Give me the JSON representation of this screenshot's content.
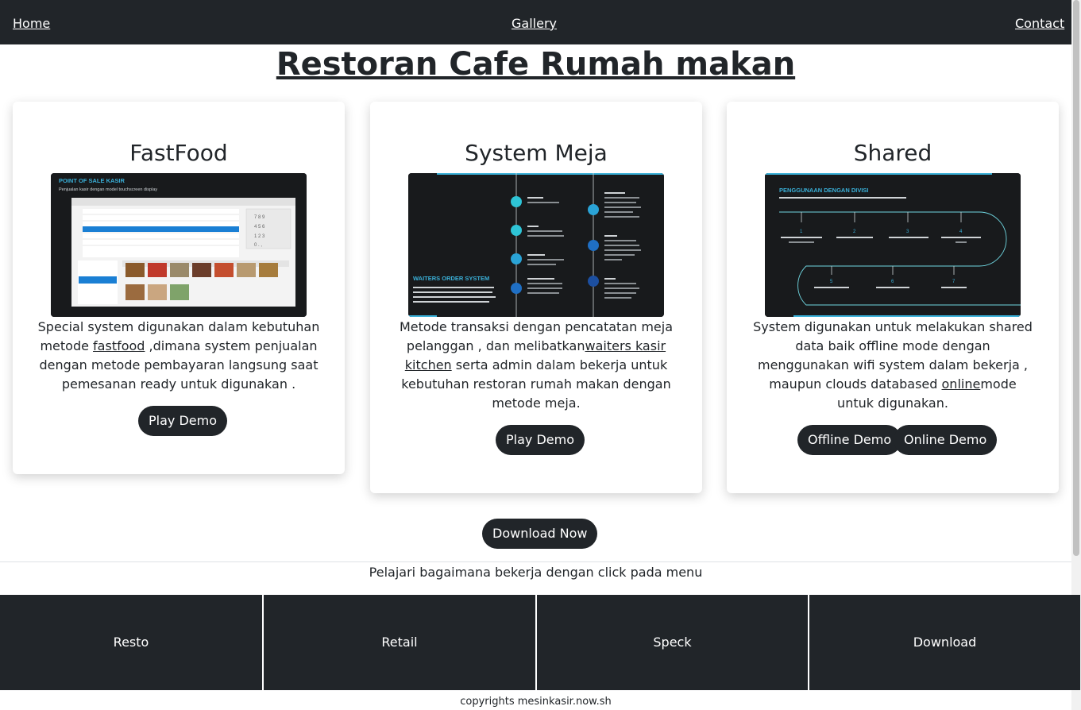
{
  "nav": {
    "home": "Home",
    "gallery": "Gallery",
    "contact": "Contact"
  },
  "page_title": "Restoran Cafe Rumah makan",
  "cards": [
    {
      "title": "FastFood",
      "image": {
        "heading": "POINT OF SALE KASIR",
        "subheading": "Penjualan kasir dengan model touchscreen display"
      },
      "desc_before": "Special system digunakan dalam kebutuhan metode ",
      "desc_link": "fastfood",
      "desc_after": " ,dimana system penjualan dengan metode pembayaran langsung saat pemesanan ready untuk digunakan .",
      "buttons": [
        "Play Demo"
      ]
    },
    {
      "title": "System Meja",
      "image": {
        "heading": "WAITERS ORDER SYSTEM",
        "subheading": "Waiters order stok melalui kasir sesuai dengan meja masing-masing pelanggan"
      },
      "desc_before": "Metode transaksi dengan pencatatan meja pelanggan , dan melibatkan",
      "desc_link": "waiters kasir kitchen",
      "desc_after": " serta admin dalam bekerja untuk kebutuhan restoran rumah makan dengan metode meja.",
      "buttons": [
        "Play Demo"
      ]
    },
    {
      "title": "Shared",
      "image": {
        "heading": "PENGGUNAAN DENGAN DIVISI",
        "subheading": "Penggunaan sistem untuk multi divisi kerja dalam satu database"
      },
      "desc_before": "System digunakan untuk melakukan shared data baik offline mode dengan menggunakan wifi system dalam bekerja , maupun clouds databased ",
      "desc_link": "online",
      "desc_after": "mode untuk digunakan.",
      "buttons": [
        "Offline Demo",
        "Online Demo"
      ]
    }
  ],
  "download_button": "Download Now",
  "learn_text": "Pelajari bagaimana bekerja dengan click pada menu",
  "bottom_menu": [
    "Resto",
    "Retail",
    "Speck",
    "Download"
  ],
  "footer": "copyrights mesinkasir.now.sh",
  "colors": {
    "dark": "#212529",
    "accent": "#3ab0d8",
    "white": "#ffffff"
  }
}
